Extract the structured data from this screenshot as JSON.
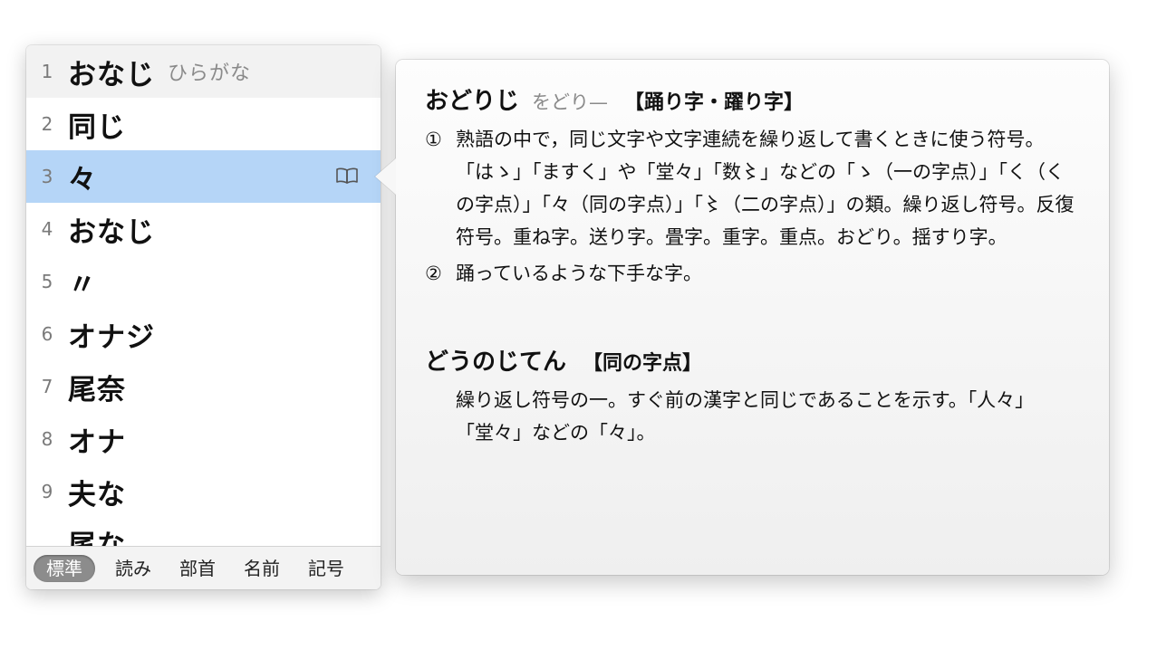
{
  "candidates": [
    {
      "num": "1",
      "text": "おなじ",
      "annotation": "ひらがな"
    },
    {
      "num": "2",
      "text": "同じ"
    },
    {
      "num": "3",
      "text": "々",
      "has_dictionary": true
    },
    {
      "num": "4",
      "text": "おなじ"
    },
    {
      "num": "5",
      "text": "〃"
    },
    {
      "num": "6",
      "text": "オナジ"
    },
    {
      "num": "7",
      "text": "尾奈"
    },
    {
      "num": "8",
      "text": "オナ"
    },
    {
      "num": "9",
      "text": "夫な"
    },
    {
      "num": "",
      "text": "尾な"
    }
  ],
  "selected_index": 3,
  "tabs": [
    {
      "label": "標準",
      "active": true
    },
    {
      "label": "読み"
    },
    {
      "label": "部首"
    },
    {
      "label": "名前"
    },
    {
      "label": "記号"
    }
  ],
  "dictionary": {
    "entry1": {
      "headword": "おどりじ",
      "note": "をどり—",
      "kanji": "【踊り字・躍り字】",
      "def1_mark": "①",
      "def1": "熟語の中で，同じ文字や文字連続を繰り返して書くときに使う符号。「はゝ」「ますく」や「堂々」「数〻」などの「ゝ（一の字点）」「く（くの字点）」「々（同の字点）」「〻（二の字点）」の類。繰り返し符号。反復符号。重ね字。送り字。畳字。重字。重点。おどり。揺すり字。",
      "def2_mark": "②",
      "def2": "踊っているような下手な字。"
    },
    "entry2": {
      "headword": "どうのじてん",
      "kanji": "【同の字点】",
      "def": "繰り返し符号の一。すぐ前の漢字と同じであることを示す。「人々」「堂々」などの「々」。"
    }
  },
  "colors": {
    "selection": "#b5d5f7",
    "active_tab": "#8c8c8c"
  }
}
